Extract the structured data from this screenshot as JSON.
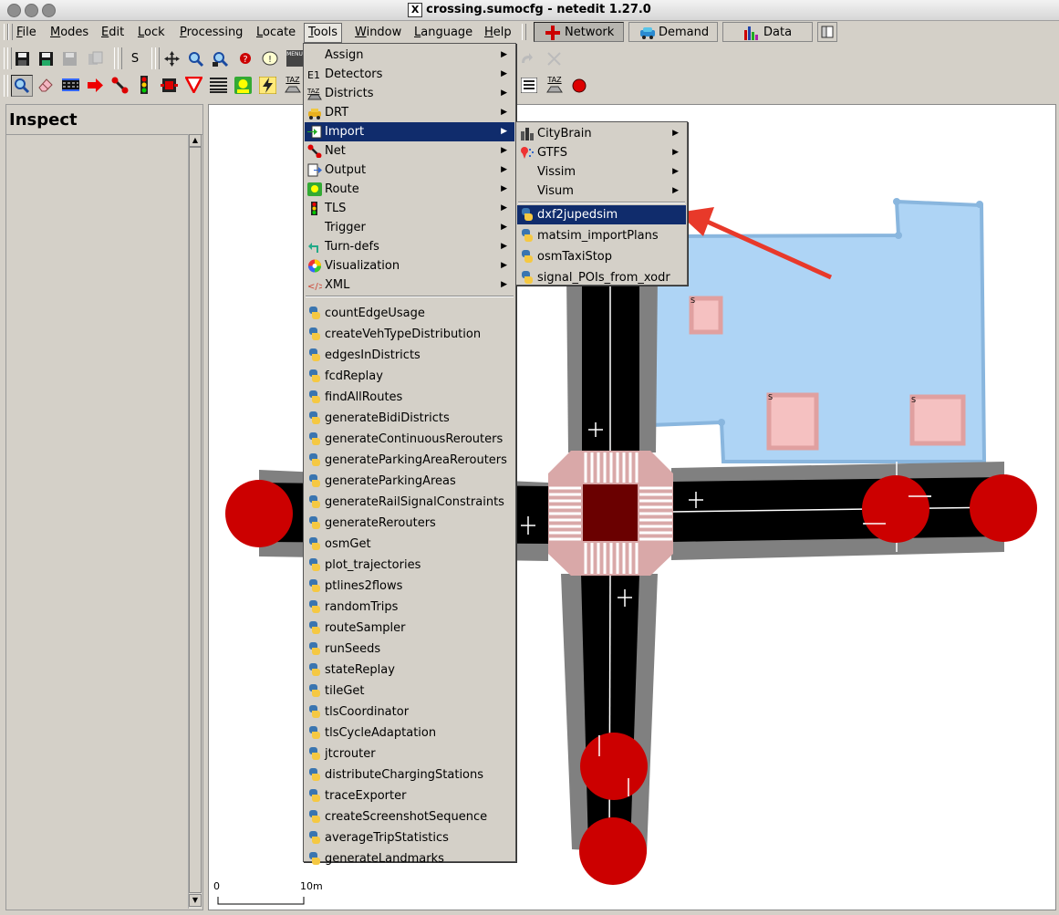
{
  "window": {
    "title": "crossing.sumocfg - netedit 1.27.0"
  },
  "menubar": [
    {
      "label": "File",
      "u": "F",
      "rest": "ile"
    },
    {
      "label": "Modes",
      "u": "M",
      "rest": "odes"
    },
    {
      "label": "Edit",
      "u": "E",
      "rest": "dit"
    },
    {
      "label": "Lock",
      "u": "L",
      "rest": "ock"
    },
    {
      "label": "Processing",
      "u": "P",
      "rest": "rocessing"
    },
    {
      "label": "Locate",
      "u": "L",
      "rest": "ocate"
    },
    {
      "label": "Tools",
      "u": "T",
      "rest": "ools"
    },
    {
      "label": "Window",
      "u": "W",
      "rest": "indow"
    },
    {
      "label": "Language",
      "u": "L",
      "rest": "anguage"
    },
    {
      "label": "Help",
      "u": "H",
      "rest": "elp"
    }
  ],
  "supermodes": {
    "network": "Network",
    "demand": "Demand",
    "data": "Data"
  },
  "toolbar": {
    "s_label": "S",
    "menu_label": "MENU",
    "taz_label": "TAZ"
  },
  "inspect": {
    "title": "Inspect"
  },
  "scale": {
    "zero": "0",
    "ten": "10m"
  },
  "tools_menu": {
    "submenus": [
      {
        "label": "Assign",
        "icon": "none"
      },
      {
        "label": "Detectors",
        "icon": "detector-e1-icon",
        "icon_text": "E1"
      },
      {
        "label": "Districts",
        "icon": "taz-icon",
        "icon_text": "TAZ"
      },
      {
        "label": "DRT",
        "icon": "taxi-icon"
      },
      {
        "label": "Import",
        "icon": "import-icon"
      },
      {
        "label": "Net",
        "icon": "net-icon"
      },
      {
        "label": "Output",
        "icon": "output-icon"
      },
      {
        "label": "Route",
        "icon": "route-icon"
      },
      {
        "label": "TLS",
        "icon": "traffic-light-icon"
      },
      {
        "label": "Trigger",
        "icon": "none"
      },
      {
        "label": "Turn-defs",
        "icon": "turn-defs-icon"
      },
      {
        "label": "Visualization",
        "icon": "color-wheel-icon"
      },
      {
        "label": "XML",
        "icon": "xml-icon",
        "icon_text": "</>"
      }
    ],
    "scripts": [
      "countEdgeUsage",
      "createVehTypeDistribution",
      "edgesInDistricts",
      "fcdReplay",
      "findAllRoutes",
      "generateBidiDistricts",
      "generateContinuousRerouters",
      "generateParkingAreaRerouters",
      "generateParkingAreas",
      "generateRailSignalConstraints",
      "generateRerouters",
      "osmGet",
      "plot_trajectories",
      "ptlines2flows",
      "randomTrips",
      "routeSampler",
      "runSeeds",
      "stateReplay",
      "tileGet",
      "tlsCoordinator",
      "tlsCycleAdaptation",
      "jtcrouter",
      "distributeChargingStations",
      "traceExporter",
      "createScreenshotSequence",
      "averageTripStatistics",
      "generateLandmarks"
    ],
    "highlighted": "Import"
  },
  "import_menu": {
    "submenus": [
      {
        "label": "CityBrain",
        "icon": "city-icon"
      },
      {
        "label": "GTFS",
        "icon": "gtfs-icon"
      },
      {
        "label": "Vissim",
        "icon": "none"
      },
      {
        "label": "Visum",
        "icon": "none"
      }
    ],
    "scripts": [
      "dxf2jupedsim",
      "matsim_importPlans",
      "osmTaxiStop",
      "signal_POIs_from_xodr"
    ],
    "highlighted": "dxf2jupedsim"
  },
  "colors": {
    "highlight": "#102c6c",
    "arrow": "#e8392a",
    "parking": "#f5c1c1",
    "walkable": "#aed4f5",
    "stop": "#cc0000"
  }
}
